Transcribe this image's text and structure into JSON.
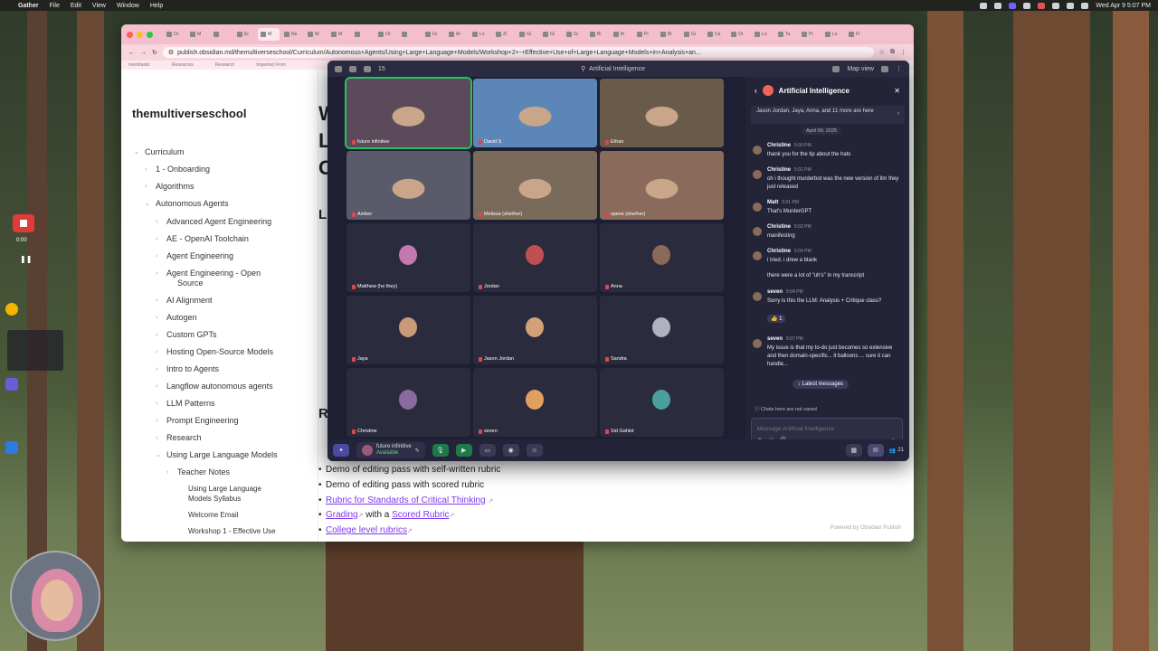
{
  "menubar": {
    "app": "Gather",
    "items": [
      "File",
      "Edit",
      "View",
      "Window",
      "Help"
    ],
    "clock": "Wed Apr 9  5:07 PM"
  },
  "recorder": {
    "time": "0:00",
    "pause_icon": "pause-icon",
    "stop_icon": "stop-icon"
  },
  "browser": {
    "tabs": [
      "Or",
      "M",
      "",
      "Er",
      "M",
      "Ne",
      "W",
      "M",
      "",
      "Or",
      "",
      "Gi",
      "Ar",
      "Lo",
      "Zi",
      "Gi",
      "Gi",
      "Gi",
      "Bi",
      "th",
      "Pr",
      "Bi",
      "Gi",
      "Ca",
      "Or",
      "Lo",
      "Ta",
      "Pi",
      "Lo",
      "Fr"
    ],
    "url": "publish.obsidian.md/themultiverseschool/Curriculum/Autonomous+Agents/Using+Large+Language+Models/Workshop+2+-+Effective+Use+of+Large+Language+Models+in+Analysis+an...",
    "bookmarks": [
      "meshtastic",
      "Resources",
      "Research",
      "Imported From"
    ]
  },
  "obsidian": {
    "site_title": "themultiverseschool",
    "nav": [
      {
        "label": "Curriculum",
        "level": 0,
        "chev": "⌄"
      },
      {
        "label": "1 - Onboarding",
        "level": 1,
        "chev": "›"
      },
      {
        "label": "Algorithms",
        "level": 1,
        "chev": "›"
      },
      {
        "label": "Autonomous Agents",
        "level": 1,
        "chev": "⌄"
      },
      {
        "label": "Advanced Agent Engineering",
        "level": 2,
        "chev": "›"
      },
      {
        "label": "AE - OpenAI Toolchain",
        "level": 2,
        "chev": "›"
      },
      {
        "label": "Agent Engineering",
        "level": 2,
        "chev": "›"
      },
      {
        "label": "Agent Engineering - Open",
        "level": 2,
        "chev": "›"
      },
      {
        "label": "Source",
        "level": 3,
        "chev": ""
      },
      {
        "label": "AI Alignment",
        "level": 2,
        "chev": "›"
      },
      {
        "label": "Autogen",
        "level": 2,
        "chev": "›"
      },
      {
        "label": "Custom GPTs",
        "level": 2,
        "chev": "›"
      },
      {
        "label": "Hosting Open-Source Models",
        "level": 2,
        "chev": "›"
      },
      {
        "label": "Intro to Agents",
        "level": 2,
        "chev": "›"
      },
      {
        "label": "Langflow autonomous agents",
        "level": 2,
        "chev": "›"
      },
      {
        "label": "LLM Patterns",
        "level": 2,
        "chev": "›"
      },
      {
        "label": "Prompt Engineering",
        "level": 2,
        "chev": "›"
      },
      {
        "label": "Research",
        "level": 2,
        "chev": "›"
      },
      {
        "label": "Using Large Language Models",
        "level": 2,
        "chev": "⌄"
      },
      {
        "label": "Teacher Notes",
        "level": 3,
        "chev": "›"
      },
      {
        "label": "Using Large Language",
        "level": 4,
        "chev": ""
      },
      {
        "label": "Models Syllabus",
        "level": 4,
        "chev": ""
      },
      {
        "label": "Welcome Email",
        "level": 4,
        "chev": ""
      },
      {
        "label": "Workshop 1 - Effective Use",
        "level": 4,
        "chev": ""
      }
    ],
    "content_letters": [
      "W",
      "L",
      "C",
      "L",
      "R"
    ],
    "bullets": [
      {
        "pre": "Demo of editing pass with self-written rubric"
      },
      {
        "pre": "Demo of editing pass with scored rubric"
      },
      {
        "link": "Rubric for Standards of Critical Thinking"
      },
      {
        "link": "Grading",
        "mid": " with a ",
        "link2": "Scored Rubric"
      },
      {
        "link": "College level rubrics"
      }
    ],
    "powered_by": "Powered by Obsidian Publish"
  },
  "gather": {
    "participants_count": "15",
    "space_name": "Artificial Intelligence",
    "map_view": "Map view",
    "tiles": [
      {
        "name": "future infinitive",
        "video": true,
        "speaking": true,
        "bg": "#5a4a5a"
      },
      {
        "name": "David S",
        "video": true,
        "bg": "#5d86b8"
      },
      {
        "name": "Ethan",
        "video": true,
        "bg": "#6a5a4a"
      },
      {
        "name": "Amber",
        "video": true,
        "bg": "#5a5a6a"
      },
      {
        "name": "Melissa (she/her)",
        "video": true,
        "bg": "#7a6a5a"
      },
      {
        "name": "spens (she/her)",
        "video": true,
        "bg": "#8a6a5a"
      },
      {
        "name": "Matthew (he they)",
        "video": false,
        "bg": "#2b2b3e"
      },
      {
        "name": "Jordan",
        "video": false,
        "bg": "#2b2b3e"
      },
      {
        "name": "Anna",
        "video": false,
        "bg": "#2b2b3e"
      },
      {
        "name": "Jaya",
        "video": false,
        "bg": "#2b2b3e"
      },
      {
        "name": "Jason Jordan",
        "video": false,
        "bg": "#2b2b3e"
      },
      {
        "name": "Sandra",
        "video": false,
        "bg": "#2b2b3e"
      },
      {
        "name": "Christine",
        "video": false,
        "bg": "#2b2b3e"
      },
      {
        "name": "seven",
        "video": false,
        "bg": "#2b2b3e"
      },
      {
        "name": "Sid Gahlot",
        "video": false,
        "bg": "#2b2b3e"
      }
    ],
    "bottom": {
      "user": "future infinitive",
      "status": "Available",
      "people_count": "21"
    },
    "chat": {
      "title": "Artificial Intelligence",
      "present": "Jason Jordan, Jaya, Anna, and 11 more are here",
      "date": "April 09, 2025",
      "messages": [
        {
          "author": "Christine",
          "time": "5:00 PM",
          "text": "thank you for the tip about the hats"
        },
        {
          "author": "Christine",
          "time": "5:01 PM",
          "text": "oh i thought murderbot was the new version of llm they just released"
        },
        {
          "author": "Matt",
          "time": "5:01 PM",
          "text": "That's MurderGPT"
        },
        {
          "author": "Christine",
          "time": "5:02 PM",
          "text": "manifesting"
        },
        {
          "author": "Christine",
          "time": "5:04 PM",
          "text": "i tried. i drew a blank"
        },
        {
          "author": "",
          "time": "",
          "text": "there were a lot of \"uh's\" in my transcript"
        },
        {
          "author": "seven",
          "time": "5:04 PM",
          "text": "Sorry is this the LLM: Analysis + Critique class?"
        },
        {
          "author": "seven",
          "time": "5:07 PM",
          "text": "My issue is that my to-do just becomes so extensive and then domain-specific... it balloons ... sure it can handle..."
        }
      ],
      "reaction": "👍 1",
      "latest": "↓ Latest messages",
      "not_saved": "Chats here are not saved",
      "placeholder": "Message Artificial Intelligence"
    }
  }
}
